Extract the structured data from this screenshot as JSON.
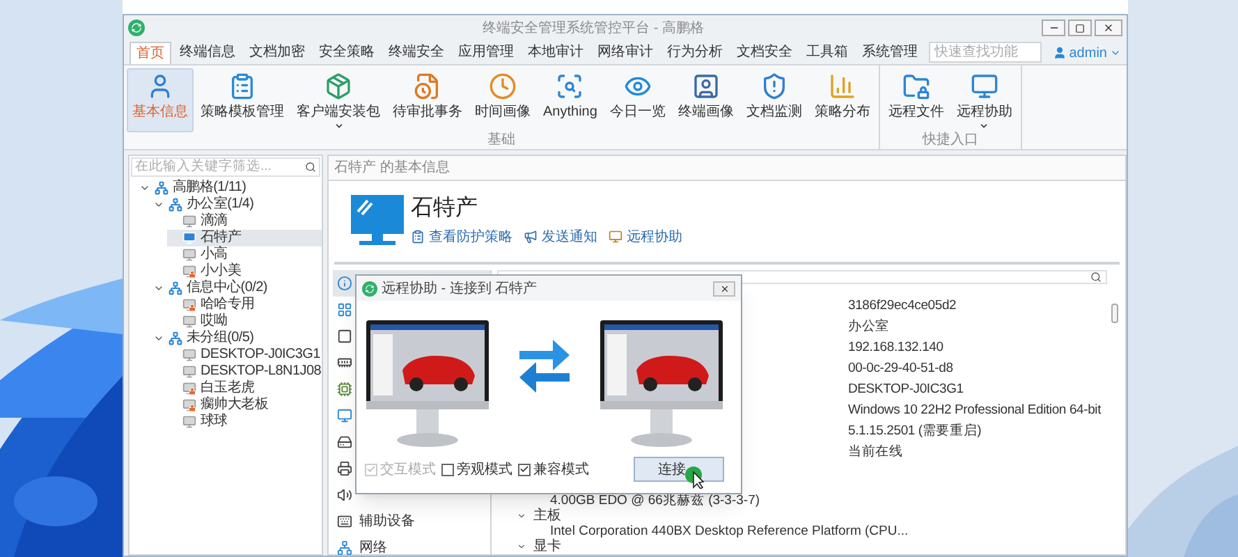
{
  "window": {
    "title": "终端安全管理系统管控平台 - 高鹏格"
  },
  "menu_tabs": [
    {
      "label": "首页",
      "selected": true
    },
    {
      "label": "终端信息",
      "selected": false
    },
    {
      "label": "文档加密",
      "selected": false
    },
    {
      "label": "安全策略",
      "selected": false
    },
    {
      "label": "终端安全",
      "selected": false
    },
    {
      "label": "应用管理",
      "selected": false
    },
    {
      "label": "本地审计",
      "selected": false
    },
    {
      "label": "网络审计",
      "selected": false
    },
    {
      "label": "行为分析",
      "selected": false
    },
    {
      "label": "文档安全",
      "selected": false
    },
    {
      "label": "工具箱",
      "selected": false
    },
    {
      "label": "系统管理",
      "selected": false
    }
  ],
  "quick_search": {
    "placeholder": "快速查找功能"
  },
  "user": {
    "name": "admin"
  },
  "ribbon_groups": [
    {
      "label": "基础",
      "buttons": [
        {
          "label": "基本信息",
          "kind": "person",
          "selected": true,
          "dropdown": false
        },
        {
          "label": "策略模板管理",
          "kind": "template",
          "selected": false,
          "dropdown": false
        },
        {
          "label": "客户端安装包",
          "kind": "package",
          "selected": false,
          "dropdown": true
        },
        {
          "label": "待审批事务",
          "kind": "approval",
          "selected": false,
          "dropdown": false
        },
        {
          "label": "时间画像",
          "kind": "clock",
          "selected": false,
          "dropdown": false
        },
        {
          "label": "Anything",
          "kind": "search",
          "selected": false,
          "dropdown": false
        },
        {
          "label": "今日一览",
          "kind": "eye",
          "selected": false,
          "dropdown": false
        },
        {
          "label": "终端画像",
          "kind": "portrait",
          "selected": false,
          "dropdown": false
        },
        {
          "label": "文档监测",
          "kind": "shield",
          "selected": false,
          "dropdown": false
        },
        {
          "label": "策略分布",
          "kind": "chart",
          "selected": false,
          "dropdown": false
        }
      ]
    },
    {
      "label": "快捷入口",
      "buttons": [
        {
          "label": "远程文件",
          "kind": "folder",
          "selected": false,
          "dropdown": false
        },
        {
          "label": "远程协助",
          "kind": "monitor",
          "selected": false,
          "dropdown": true
        }
      ]
    }
  ],
  "tree": {
    "placeholder": "在此输入关键字筛选...",
    "nodes": [
      {
        "label": "高鹏格(1/11)",
        "kind": "group",
        "expanded": true,
        "selected": false,
        "children": [
          {
            "label": "办公室(1/4)",
            "kind": "group",
            "expanded": true,
            "selected": false,
            "children": [
              {
                "label": "滴滴",
                "kind": "offline",
                "selected": false
              },
              {
                "label": "石特产",
                "kind": "online",
                "selected": true
              },
              {
                "label": "小高",
                "kind": "offline",
                "selected": false
              },
              {
                "label": "小小美",
                "kind": "locked",
                "selected": false
              }
            ]
          },
          {
            "label": "信息中心(0/2)",
            "kind": "group",
            "expanded": true,
            "selected": false,
            "children": [
              {
                "label": "哈哈专用",
                "kind": "locked",
                "selected": false
              },
              {
                "label": "哎呦",
                "kind": "offline",
                "selected": false
              }
            ]
          },
          {
            "label": "未分组(0/5)",
            "kind": "group",
            "expanded": true,
            "selected": false,
            "children": [
              {
                "label": "DESKTOP-J0IC3G1",
                "kind": "offline",
                "selected": false
              },
              {
                "label": "DESKTOP-L8N1J08",
                "kind": "offline",
                "selected": false
              },
              {
                "label": "白玉老虎",
                "kind": "locked",
                "selected": false
              },
              {
                "label": "瘸帅大老板",
                "kind": "locked",
                "selected": false
              },
              {
                "label": "球球",
                "kind": "offline",
                "selected": false
              }
            ]
          }
        ]
      }
    ]
  },
  "detail_header": {
    "title": "石特产 的基本信息"
  },
  "device": {
    "name": "石特产",
    "actions": [
      {
        "label": "查看防护策略",
        "kind": "policy"
      },
      {
        "label": "发送通知",
        "kind": "notify"
      },
      {
        "label": "远程协助",
        "kind": "remote"
      }
    ]
  },
  "categories": [
    {
      "kind": "info",
      "selected": true
    },
    {
      "kind": "windows",
      "selected": false
    },
    {
      "kind": "board",
      "selected": false
    },
    {
      "kind": "memory",
      "selected": false
    },
    {
      "kind": "chip",
      "selected": false
    },
    {
      "kind": "display",
      "selected": false
    },
    {
      "kind": "drive",
      "selected": false
    },
    {
      "kind": "printer",
      "selected": false
    },
    {
      "kind": "audio",
      "selected": false
    },
    {
      "kind": "keyboard",
      "label": "辅助设备",
      "selected": false
    },
    {
      "kind": "network",
      "label": "网络",
      "selected": false
    }
  ],
  "details": {
    "values": [
      "3186f29ec4ce05d2",
      "办公室",
      "192.168.132.140",
      "00-0c-29-40-51-d8",
      "DESKTOP-J0IC3G1",
      "Windows 10 22H2 Professional Edition 64-bit",
      "5.1.15.2501 (需要重启)",
      "当前在线"
    ],
    "rows": [
      {
        "kind": "item",
        "text": "4.00GB EDO @ 66兆赫兹 (3-3-3-7)"
      },
      {
        "kind": "heading",
        "text": "主板",
        "expanded": true
      },
      {
        "kind": "item",
        "text": "Intel Corporation 440BX Desktop Reference Platform (CPU..."
      },
      {
        "kind": "heading",
        "text": "显卡",
        "expanded": true
      }
    ]
  },
  "dialog": {
    "title": "远程协助 - 连接到 石特产",
    "options": [
      {
        "label": "交互模式",
        "checked": true,
        "disabled": true
      },
      {
        "label": "旁观模式",
        "checked": false,
        "disabled": false
      },
      {
        "label": "兼容模式",
        "checked": true,
        "disabled": false
      }
    ],
    "connect_button": "连接"
  }
}
